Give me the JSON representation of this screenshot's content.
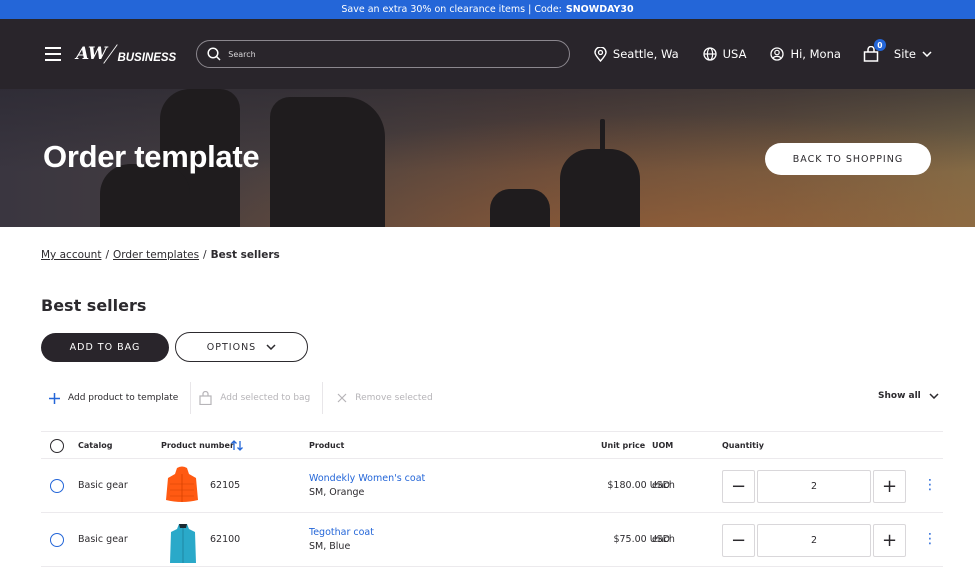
{
  "promo": {
    "text": "Save an extra 30% on clearance items | Code:",
    "code": "SNOWDAY30"
  },
  "header": {
    "logo_main": "AW",
    "logo_sub": "BUSINESS",
    "search_placeholder": "Search",
    "location": "Seattle, Wa",
    "country": "USA",
    "greeting": "Hi, Mona",
    "bag_count": "0",
    "site_label": "Site"
  },
  "hero": {
    "title": "Order template",
    "back_button": "BACK TO SHOPPING"
  },
  "breadcrumb": {
    "items": [
      "My account",
      "Order templates"
    ],
    "separator": "/",
    "current": "Best sellers"
  },
  "page": {
    "title": "Best sellers",
    "add_to_bag": "ADD TO BAG",
    "options": "OPTIONS"
  },
  "toolbar": {
    "add_product": "Add product to template",
    "add_selected": "Add selected to bag",
    "remove_selected": "Remove selected",
    "show_all": "Show all"
  },
  "table": {
    "headers": {
      "catalog": "Catalog",
      "product_number": "Product number",
      "product": "Product",
      "unit_price": "Unit price",
      "uom": "UOM",
      "quantity": "Quantitiy"
    },
    "rows": [
      {
        "catalog": "Basic gear",
        "product_number": "62105",
        "product_name": "Wondekly Women's coat",
        "variant": "SM, Orange",
        "unit_price": "$180.00 USD",
        "uom": "each",
        "quantity": "2",
        "image": "orange-jacket"
      },
      {
        "catalog": "Basic gear",
        "product_number": "62100",
        "product_name": "Tegothar coat",
        "variant": "SM, Blue",
        "unit_price": "$75.00 USD",
        "uom": "each",
        "quantity": "2",
        "image": "blue-jacket"
      }
    ]
  },
  "colors": {
    "accent": "#2466d8",
    "header_bg": "#29252b",
    "promo_bg": "#2466d8"
  }
}
